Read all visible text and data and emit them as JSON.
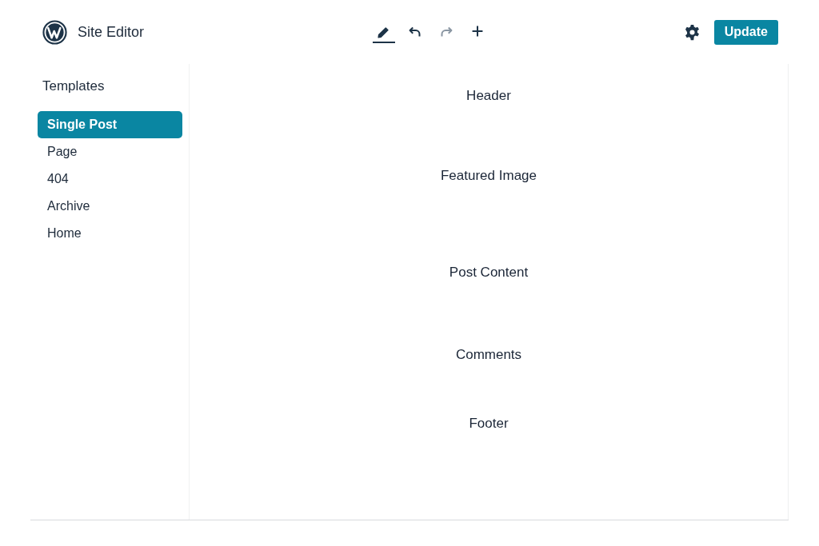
{
  "app": {
    "title": "Site Editor"
  },
  "toolbar": {
    "tools": [
      {
        "kind": "edit",
        "selected": true,
        "disabled": false
      },
      {
        "kind": "undo",
        "selected": false,
        "disabled": false
      },
      {
        "kind": "redo",
        "selected": false,
        "disabled": true
      },
      {
        "kind": "add",
        "selected": false,
        "disabled": false
      }
    ]
  },
  "actions": {
    "primary_button": "Update"
  },
  "sidebar": {
    "heading": "Templates",
    "items": [
      {
        "label": "Single Post",
        "selected": true
      },
      {
        "label": "Page",
        "selected": false
      },
      {
        "label": "404",
        "selected": false
      },
      {
        "label": "Archive",
        "selected": false
      },
      {
        "label": "Home",
        "selected": false
      }
    ]
  },
  "canvas": {
    "blocks": [
      {
        "label": "Header"
      },
      {
        "label": "Featured Image"
      },
      {
        "label": "Post Content"
      },
      {
        "label": "Comments"
      },
      {
        "label": "Footer"
      }
    ]
  }
}
